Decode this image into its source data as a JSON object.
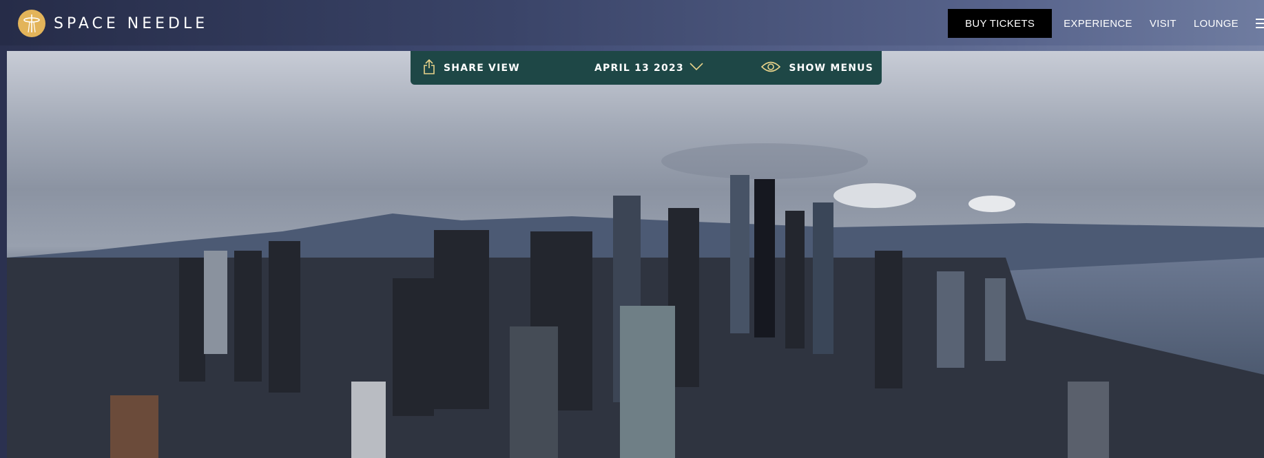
{
  "header": {
    "logo_text": "SPACE NEEDLE",
    "buy_tickets": "BUY TICKETS",
    "nav": [
      "EXPERIENCE",
      "VISIT",
      "LOUNGE"
    ]
  },
  "toolbar": {
    "share_label": "SHARE VIEW",
    "date_label": "APRIL 13 2023",
    "show_menus_label": "SHOW MENUS"
  },
  "colors": {
    "toolbar_bg": "#1e4746",
    "logo_gold": "#e3b45a",
    "icon_gold": "#e8d38a",
    "buy_button_bg": "#000000"
  },
  "icons": [
    "space-needle-logo-icon",
    "share-icon",
    "chevron-down-icon",
    "eye-icon",
    "hamburger-menu-icon"
  ]
}
